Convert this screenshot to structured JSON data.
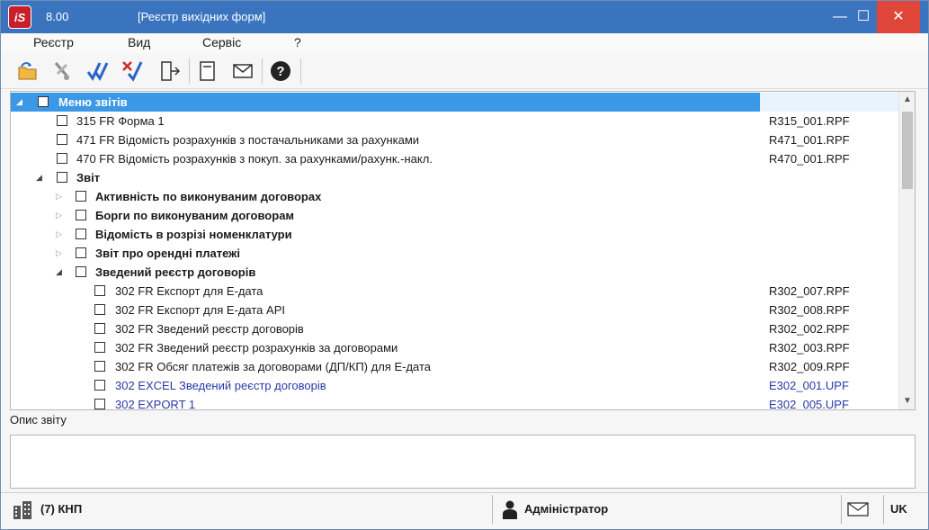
{
  "window": {
    "version": "8.00",
    "title": "[Реєстр вихідних форм]",
    "minimize_glyph": "—",
    "maximize_glyph": "☐",
    "close_glyph": "✕"
  },
  "menu": [
    "Реєстр",
    "Вид",
    "Сервіс",
    "?"
  ],
  "toolbar": {
    "icons": [
      "open-folder-icon",
      "cut-icon",
      "check-all-icon",
      "uncheck-all-icon",
      "exit-icon",
      "document-icon",
      "mail-icon",
      "help-icon"
    ]
  },
  "tree": {
    "rows": [
      {
        "label": "Меню звітів",
        "file": "",
        "selected": true
      },
      {
        "label": "315 FR Форма 1",
        "file": "R315_001.RPF"
      },
      {
        "label": "471 FR Відомість розрахунків з постачальниками за рахунками",
        "file": "R471_001.RPF"
      },
      {
        "label": "470 FR Відомість розрахунків з покуп. за рахунками/рахунк.-накл.",
        "file": "R470_001.RPF"
      },
      {
        "label": "Звіт",
        "file": ""
      },
      {
        "label": "Активність по виконуваним договорах",
        "file": ""
      },
      {
        "label": "Борги по виконуваним договорам",
        "file": ""
      },
      {
        "label": "Відомість в розрізі номенклатури",
        "file": ""
      },
      {
        "label": "Звіт про орендні платежі",
        "file": ""
      },
      {
        "label": "Зведений реєстр договорів",
        "file": ""
      },
      {
        "label": "302 FR Експорт для Е-дата",
        "file": "R302_007.RPF"
      },
      {
        "label": "302 FR Експорт для Е-дата API",
        "file": "R302_008.RPF"
      },
      {
        "label": "302 FR Зведений реєстр договорів",
        "file": "R302_002.RPF"
      },
      {
        "label": "302 FR Зведений реєстр розрахунків за договорами",
        "file": "R302_003.RPF"
      },
      {
        "label": "302 FR Обсяг платежів за договорами (ДП/КП)  для Е-дата",
        "file": "R302_009.RPF"
      },
      {
        "label": "302 EXCEL Зведений реєстр договорів",
        "file": "E302_001.UPF"
      },
      {
        "label": "302 EXPORT 1",
        "file": "E302_005.UPF"
      }
    ]
  },
  "description": {
    "label": "Опис звіту",
    "text": ""
  },
  "statusbar": {
    "org": "(7) КНП",
    "user": "Адміністратор",
    "lang": "UK"
  },
  "colors": {
    "title_bar": "#3a74bf",
    "selection": "#3a98e6",
    "excel_item": "#2a3aa8",
    "close_button": "#e0453a"
  }
}
